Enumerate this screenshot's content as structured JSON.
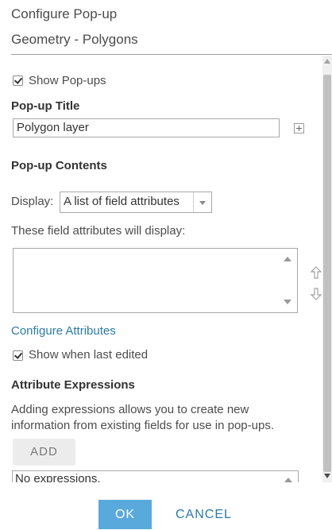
{
  "header": {
    "title": "Configure Pop-up",
    "subtitle": "Geometry - Polygons"
  },
  "popup": {
    "show_popups_label": "Show Pop-ups",
    "show_popups_checked": true,
    "title_heading": "Pop-up Title",
    "title_value": "Polygon layer",
    "contents_heading": "Pop-up Contents",
    "display_label": "Display:",
    "display_value": "A list of field attributes",
    "fields_caption": "These field attributes will display:",
    "configure_link": "Configure Attributes",
    "show_last_edited_label": "Show when last edited",
    "show_last_edited_checked": true
  },
  "expressions": {
    "heading": "Attribute Expressions",
    "description": "Adding expressions allows you to create new information from existing fields for use in pop-ups.",
    "add_label": "ADD",
    "empty_text": "No expressions."
  },
  "footer": {
    "ok_label": "OK",
    "cancel_label": "CANCEL"
  },
  "colors": {
    "accent": "#5aa9dc",
    "link": "#2b7aa6",
    "text": "#4c4c4c"
  }
}
